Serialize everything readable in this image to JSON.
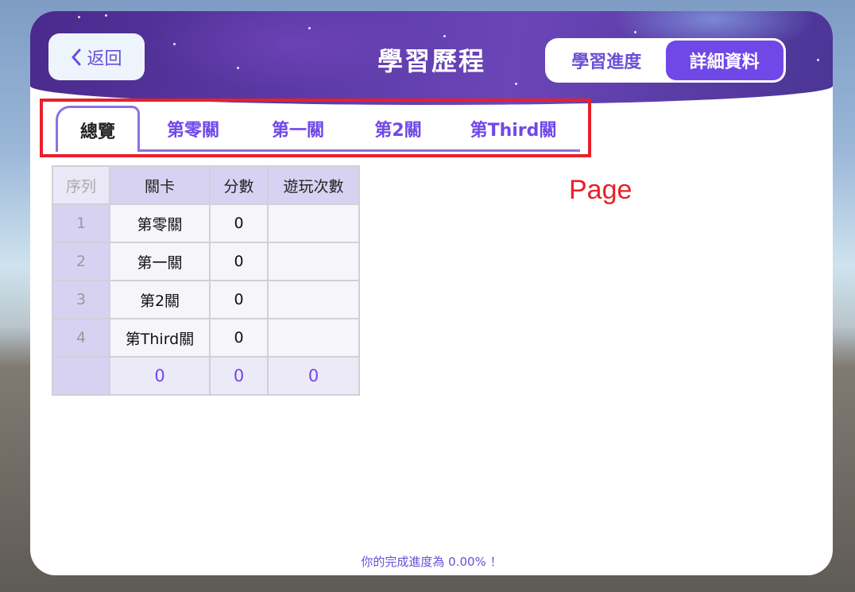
{
  "header": {
    "back_label": "返回",
    "title": "學習歷程",
    "toggle": [
      {
        "label": "學習進度",
        "active": false
      },
      {
        "label": "詳細資料",
        "active": true
      }
    ]
  },
  "tabs": [
    {
      "label": "總覽",
      "active": true
    },
    {
      "label": "第零關",
      "active": false
    },
    {
      "label": "第一關",
      "active": false
    },
    {
      "label": "第2關",
      "active": false
    },
    {
      "label": "第Third關",
      "active": false
    }
  ],
  "annotation": {
    "label": "Page"
  },
  "table": {
    "headers": [
      "序列",
      "關卡",
      "分數",
      "遊玩次數"
    ],
    "rows": [
      {
        "index": "1",
        "level": "第零關",
        "score": "0",
        "plays": ""
      },
      {
        "index": "2",
        "level": "第一關",
        "score": "0",
        "plays": ""
      },
      {
        "index": "3",
        "level": "第2關",
        "score": "0",
        "plays": ""
      },
      {
        "index": "4",
        "level": "第Third關",
        "score": "0",
        "plays": ""
      }
    ],
    "totals": {
      "index": "",
      "level": "0",
      "score": "0",
      "plays": "0"
    }
  },
  "footer": {
    "progress_text": "你的完成進度為 0.00% ！"
  },
  "colors": {
    "accent": "#7048e8",
    "highlight_box": "#e8202a"
  },
  "icons": {
    "back": "chevron-left-icon"
  }
}
